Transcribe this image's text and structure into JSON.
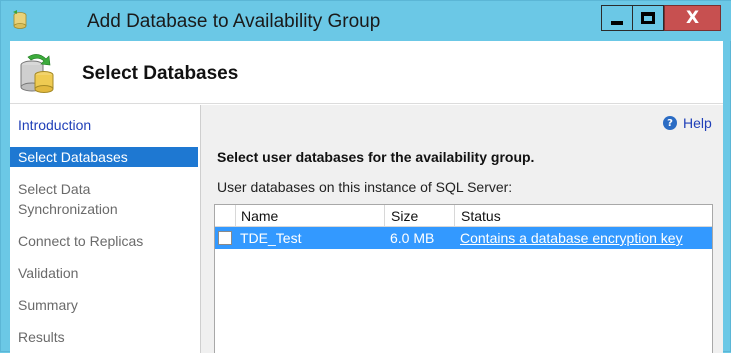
{
  "window": {
    "title": "Add Database to Availability Group",
    "controls": {
      "minimize": "minimize",
      "maximize": "maximize",
      "close": "X"
    }
  },
  "header": {
    "title": "Select Databases",
    "icon": "database-refresh-icon"
  },
  "nav": {
    "items": [
      {
        "label": "Introduction",
        "state": "link"
      },
      {
        "label": "Select Databases",
        "state": "active"
      },
      {
        "label": "Select Data Synchronization",
        "state": "disabled"
      },
      {
        "label": "Connect to Replicas",
        "state": "disabled"
      },
      {
        "label": "Validation",
        "state": "disabled"
      },
      {
        "label": "Summary",
        "state": "disabled"
      },
      {
        "label": "Results",
        "state": "disabled"
      }
    ]
  },
  "main": {
    "help_label": "Help",
    "instructions": "Select user databases for the availability group.",
    "grid_label": "User databases on this instance of SQL Server:",
    "columns": {
      "name": "Name",
      "size": "Size",
      "status": "Status"
    },
    "rows": [
      {
        "checked": false,
        "name": "TDE_Test",
        "size": "6.0 MB",
        "status": "Contains a database encryption key"
      }
    ]
  },
  "colors": {
    "titlebar": "#6bc8e6",
    "close_button": "#c75050",
    "selection": "#3399ff",
    "nav_active": "#1e78d2",
    "link": "#1f3fb8"
  }
}
